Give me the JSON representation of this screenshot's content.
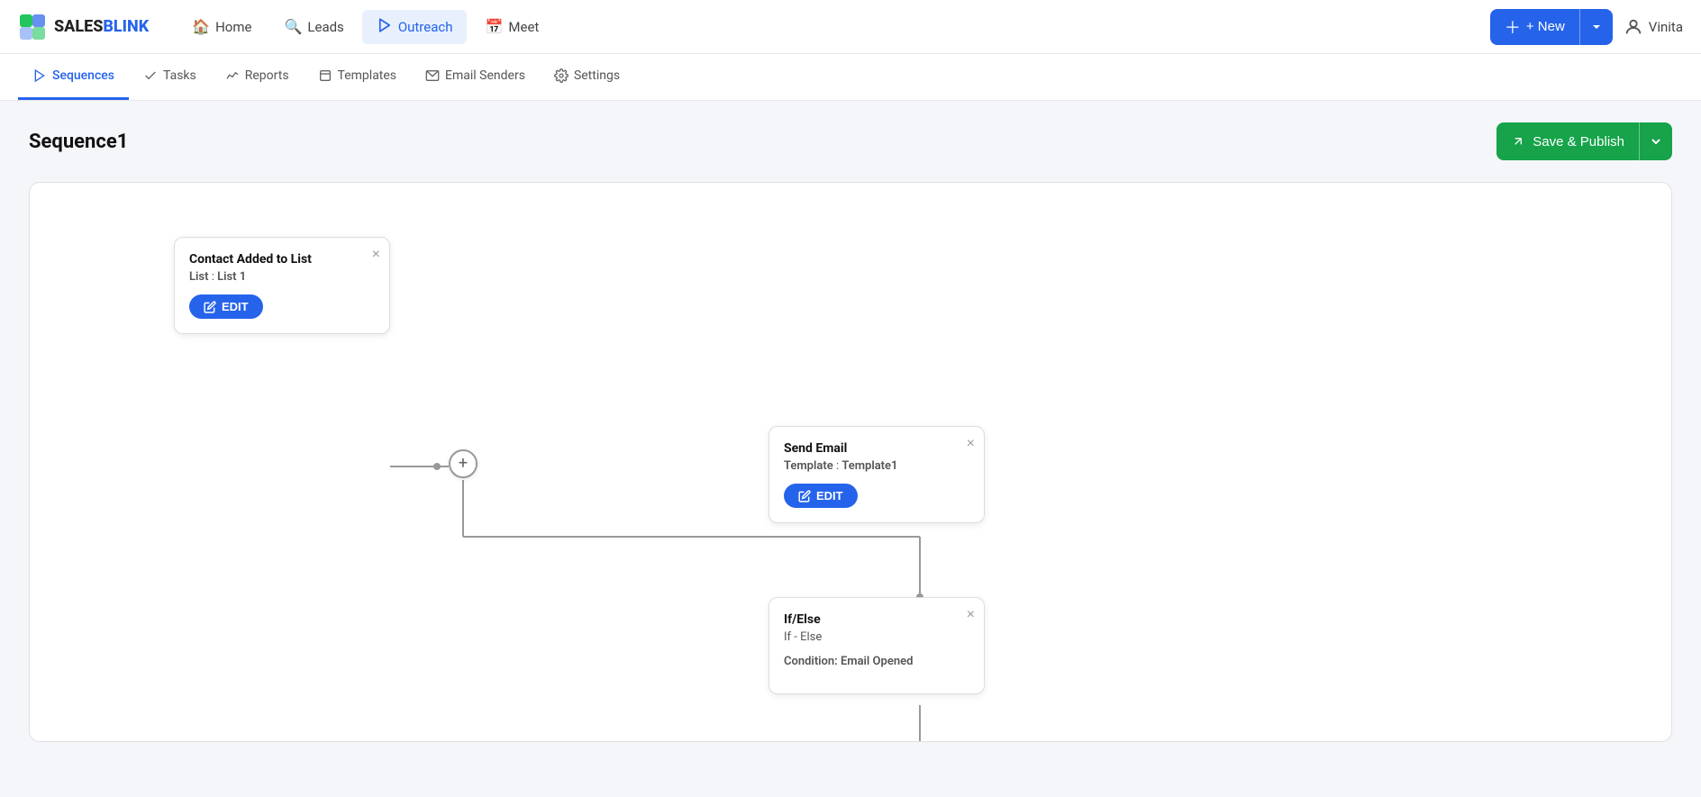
{
  "logo": {
    "sales": "SALES",
    "blink": "BLINK"
  },
  "topNav": {
    "items": [
      {
        "id": "home",
        "label": "Home",
        "icon": "🏠",
        "active": false
      },
      {
        "id": "leads",
        "label": "Leads",
        "icon": "🔍",
        "active": false
      },
      {
        "id": "outreach",
        "label": "Outreach",
        "icon": "▷",
        "active": true
      },
      {
        "id": "meet",
        "label": "Meet",
        "icon": "📅",
        "active": false
      }
    ],
    "newButton": "+ New",
    "userName": "Vinita"
  },
  "subNav": {
    "items": [
      {
        "id": "sequences",
        "label": "Sequences",
        "active": true
      },
      {
        "id": "tasks",
        "label": "Tasks",
        "active": false
      },
      {
        "id": "reports",
        "label": "Reports",
        "active": false
      },
      {
        "id": "templates",
        "label": "Templates",
        "active": false
      },
      {
        "id": "email-senders",
        "label": "Email Senders",
        "active": false
      },
      {
        "id": "settings",
        "label": "Settings",
        "active": false
      }
    ]
  },
  "page": {
    "title": "Sequence1",
    "savePublishLabel": "Save & Publish"
  },
  "flow": {
    "nodes": {
      "trigger": {
        "title": "Contact Added to List",
        "detailLabel": "List",
        "detailValue": "List 1",
        "editLabel": "EDIT"
      },
      "sendEmail": {
        "title": "Send Email",
        "detailLabel": "Template",
        "detailValue": "Template1",
        "editLabel": "EDIT"
      },
      "ifElse": {
        "title": "If/Else",
        "line1": "If - Else",
        "detailLabel": "Condition:",
        "detailValue": "Email Opened"
      }
    }
  }
}
